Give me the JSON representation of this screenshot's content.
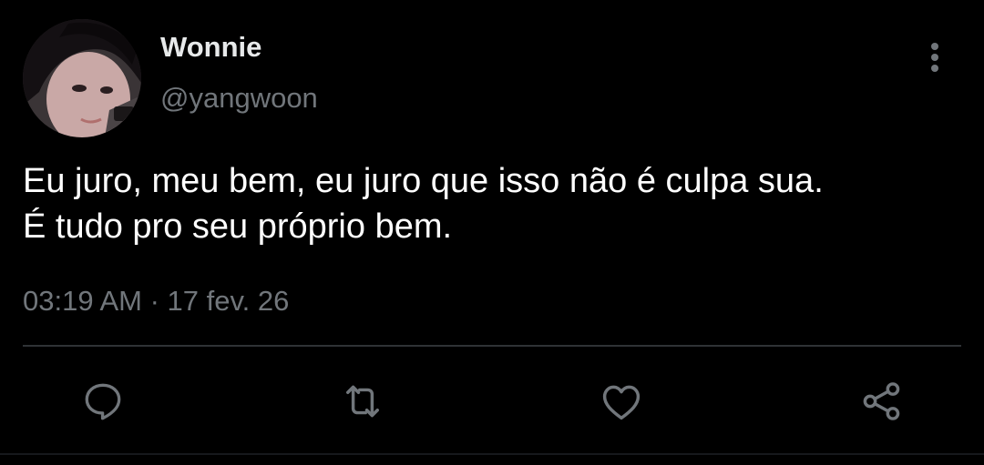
{
  "author": {
    "display_name": "Wonnie",
    "handle": "@yangwoon"
  },
  "tweet": {
    "line1": "Eu juro, meu bem, eu juro que isso não é culpa sua.",
    "line2": "É tudo pro seu próprio bem.",
    "meta": "03:19 AM · 17 fev. 26"
  },
  "actions": {
    "icons": [
      "reply-icon",
      "retweet-icon",
      "like-icon",
      "share-icon"
    ]
  },
  "colors": {
    "background": "#000000",
    "secondary_text": "#71767b",
    "divider": "#2f3336"
  }
}
